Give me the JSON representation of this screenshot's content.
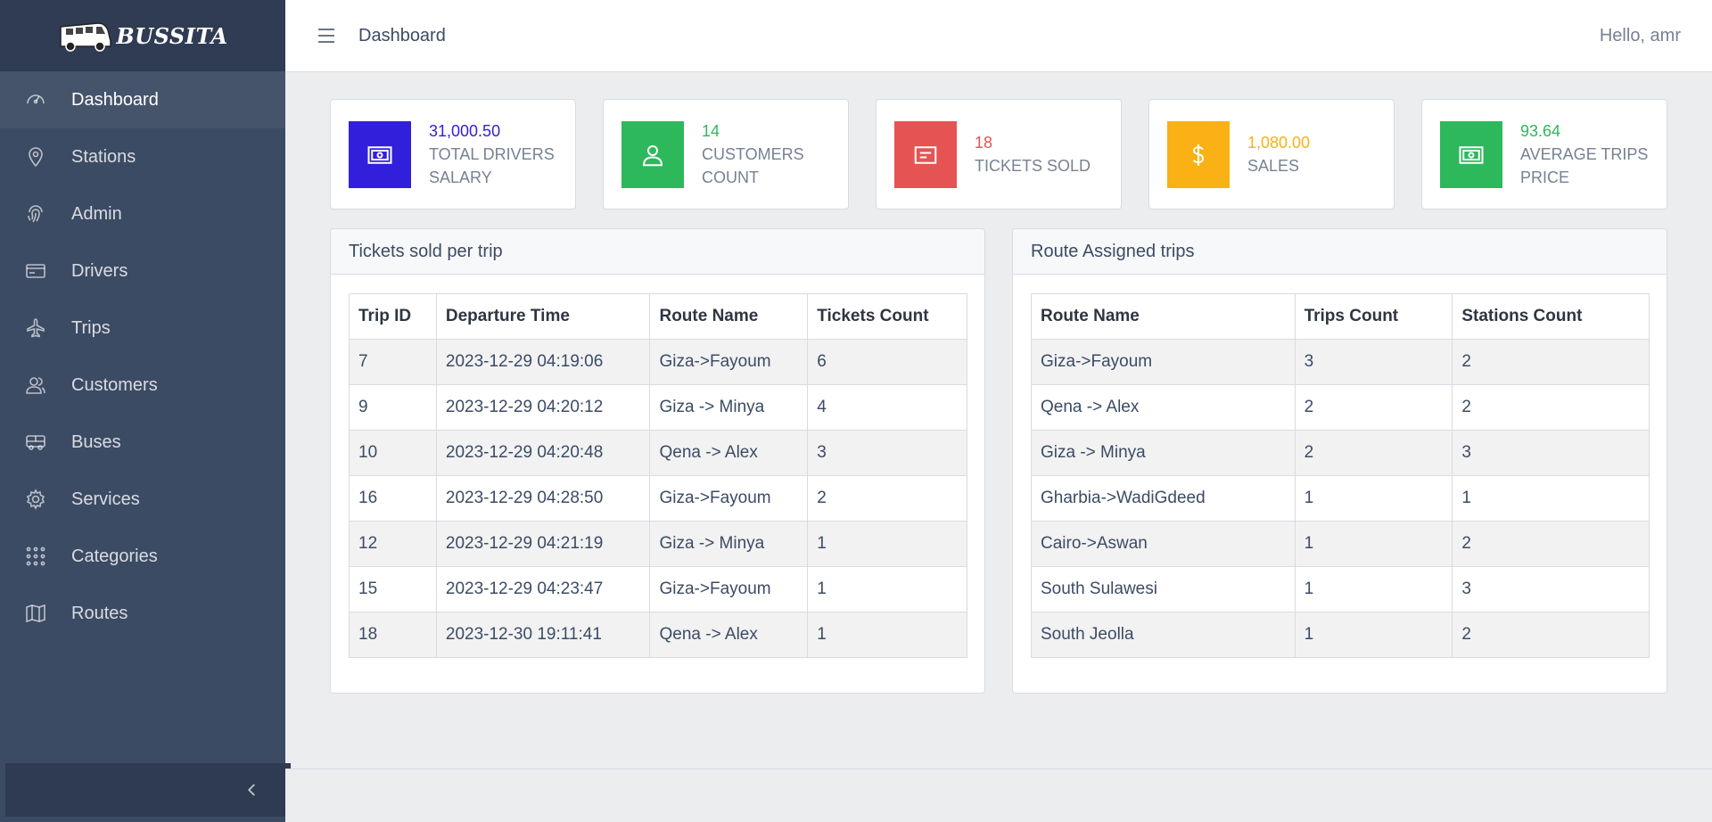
{
  "brand": {
    "name": "BUSSITA"
  },
  "sidebar": {
    "items": [
      {
        "label": "Dashboard",
        "icon": "speedometer-icon",
        "active": true
      },
      {
        "label": "Stations",
        "icon": "location-pin-icon"
      },
      {
        "label": "Admin",
        "icon": "fingerprint-icon"
      },
      {
        "label": "Drivers",
        "icon": "credit-card-icon"
      },
      {
        "label": "Trips",
        "icon": "airplane-icon"
      },
      {
        "label": "Customers",
        "icon": "people-icon"
      },
      {
        "label": "Buses",
        "icon": "bus-icon"
      },
      {
        "label": "Services",
        "icon": "gear-icon"
      },
      {
        "label": "Categories",
        "icon": "grid-dots-icon"
      },
      {
        "label": "Routes",
        "icon": "map-book-icon"
      }
    ]
  },
  "header": {
    "title": "Dashboard",
    "greeting": "Hello, amr"
  },
  "stats": [
    {
      "value": "31,000.50",
      "label": "TOTAL DRIVERS SALARY",
      "color": "#321fdb",
      "icon": "money-icon"
    },
    {
      "value": "14",
      "label": "CUSTOMERS COUNT",
      "color": "#2eb85c",
      "icon": "user-icon"
    },
    {
      "value": "18",
      "label": "TICKETS SOLD",
      "color": "#e55353",
      "icon": "ticket-icon"
    },
    {
      "value": "1,080.00",
      "label": "SALES",
      "color": "#f9b115",
      "icon": "dollar-icon"
    },
    {
      "value": "93.64",
      "label": "AVERAGE TRIPS PRICE",
      "color": "#2eb85c",
      "icon": "money-icon"
    }
  ],
  "tickets_table": {
    "title": "Tickets sold per trip",
    "columns": [
      "Trip ID",
      "Departure Time",
      "Route Name",
      "Tickets Count"
    ],
    "rows": [
      [
        "7",
        "2023-12-29 04:19:06",
        "Giza->Fayoum",
        "6"
      ],
      [
        "9",
        "2023-12-29 04:20:12",
        "Giza -> Minya",
        "4"
      ],
      [
        "10",
        "2023-12-29 04:20:48",
        "Qena -> Alex",
        "3"
      ],
      [
        "16",
        "2023-12-29 04:28:50",
        "Giza->Fayoum",
        "2"
      ],
      [
        "12",
        "2023-12-29 04:21:19",
        "Giza -> Minya",
        "1"
      ],
      [
        "15",
        "2023-12-29 04:23:47",
        "Giza->Fayoum",
        "1"
      ],
      [
        "18",
        "2023-12-30 19:11:41",
        "Qena -> Alex",
        "1"
      ]
    ]
  },
  "routes_table": {
    "title": "Route Assigned trips",
    "columns": [
      "Route Name",
      "Trips Count",
      "Stations Count"
    ],
    "rows": [
      [
        "Giza->Fayoum",
        "3",
        "2"
      ],
      [
        "Qena -> Alex",
        "2",
        "2"
      ],
      [
        "Giza -> Minya",
        "2",
        "3"
      ],
      [
        "Gharbia->WadiGdeed",
        "1",
        "1"
      ],
      [
        "Cairo->Aswan",
        "1",
        "2"
      ],
      [
        "South Sulawesi",
        "1",
        "3"
      ],
      [
        "South Jeolla",
        "1",
        "2"
      ]
    ]
  }
}
